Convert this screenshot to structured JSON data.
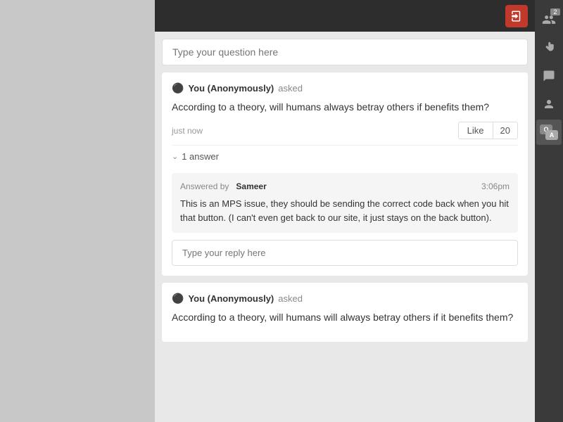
{
  "topbar": {
    "logout_icon": "→"
  },
  "search": {
    "placeholder": "Type your question here"
  },
  "question1": {
    "user": "You (Anonymously)",
    "action": "asked",
    "text": "According to a theory, will humans always betray others if benefits them?",
    "timestamp": "just now",
    "like_label": "Like",
    "like_count": "20",
    "answers_label": "1 answer",
    "answer": {
      "answered_by_label": "Answered by",
      "answerer": "Sameer",
      "time": "3:06pm",
      "text": "This is an MPS issue, they should be sending the correct code back when you hit that button. (I can't even get back to our site, it just stays on the back button)."
    },
    "reply_placeholder": "Type your reply here"
  },
  "question2": {
    "user": "You (Anonymously)",
    "action": "asked",
    "text": "According to a theory, will humans will always betray others if it benefits them?"
  },
  "sidebar": {
    "users_badge": "2",
    "icons": [
      "users",
      "hand",
      "chat",
      "person",
      "qa"
    ]
  }
}
